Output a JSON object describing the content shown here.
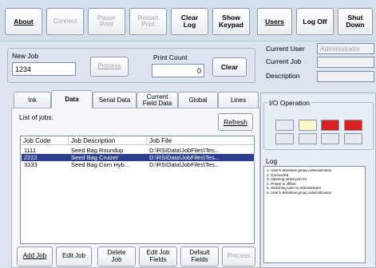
{
  "toolbar": {
    "about": "About",
    "connect": "Connect",
    "pause_print": "Pause\nPrint",
    "restart_print": "Restart\nPrint",
    "clear_log": "Clear\nLog",
    "show_keypad": "Show\nKeypad",
    "users": "Users",
    "log_off": "Log Off",
    "shut_down": "Shut\nDown"
  },
  "job": {
    "new_job_label": "New Job",
    "new_job_value": "1234",
    "process_label": "Process",
    "print_count_label": "Print Count",
    "print_count_value": "0",
    "clear_label": "Clear"
  },
  "user_info": {
    "current_user_label": "Current User",
    "current_user_value": "Administrator",
    "current_job_label": "Current Job",
    "current_job_value": "",
    "description_label": "Description",
    "description_value": ""
  },
  "tabs": [
    "Ink",
    "Data",
    "Serial Data",
    "Current\nField Data",
    "Global",
    "Lines"
  ],
  "active_tab": "Data",
  "jobs": {
    "list_label": "List of jobs:",
    "refresh_label": "Refresh",
    "columns": [
      "Job Code",
      "Job Description",
      "Job File"
    ],
    "rows": [
      {
        "code": "1111",
        "description": "Seed Bag Roundup",
        "file": "D:\\RSIData\\JobFiles\\Tes..."
      },
      {
        "code": "2222",
        "description": "Seed Bag Cruizer",
        "file": "D:\\RSIData\\JobFiles\\Tes..."
      },
      {
        "code": "3333",
        "description": "Seed Bag Corn Hyb...",
        "file": "D:\\RSIData\\JobFiles\\Tes..."
      }
    ],
    "selected_row": 1
  },
  "bottom_buttons": {
    "add_job": "Add Job",
    "edit_job": "Edit Job",
    "delete_job": "Delete\nJob",
    "edit_job_fields": "Edit Job\nFields",
    "default_fields": "Default\nFields",
    "process": "Process"
  },
  "io": {
    "title": "I/O Operation",
    "indicators": [
      {
        "color": "#e6e9ef"
      },
      {
        "color": "#fdf7c8"
      },
      {
        "color": "#d92020"
      },
      {
        "color": "#d92020"
      },
      {
        "color": "#e6e9ef"
      },
      {
        "color": "#e6e9ef"
      },
      {
        "color": "#e6e9ef"
      },
      {
        "color": "#e6e9ef"
      }
    ]
  },
  "log": {
    "title": "Log",
    "entries": [
      "1. User's Windows group Administrators",
      "2. Connected",
      "3. Opening serial port #1",
      "4. Printer is offline",
      "5. Switching user to Administrator",
      "6. User's Windows group Administrators"
    ]
  },
  "colors": {
    "background": "#dbe4ef",
    "selection": "#2c3f8e",
    "indicator_red": "#d92020",
    "indicator_yellow": "#fdf7c8"
  }
}
